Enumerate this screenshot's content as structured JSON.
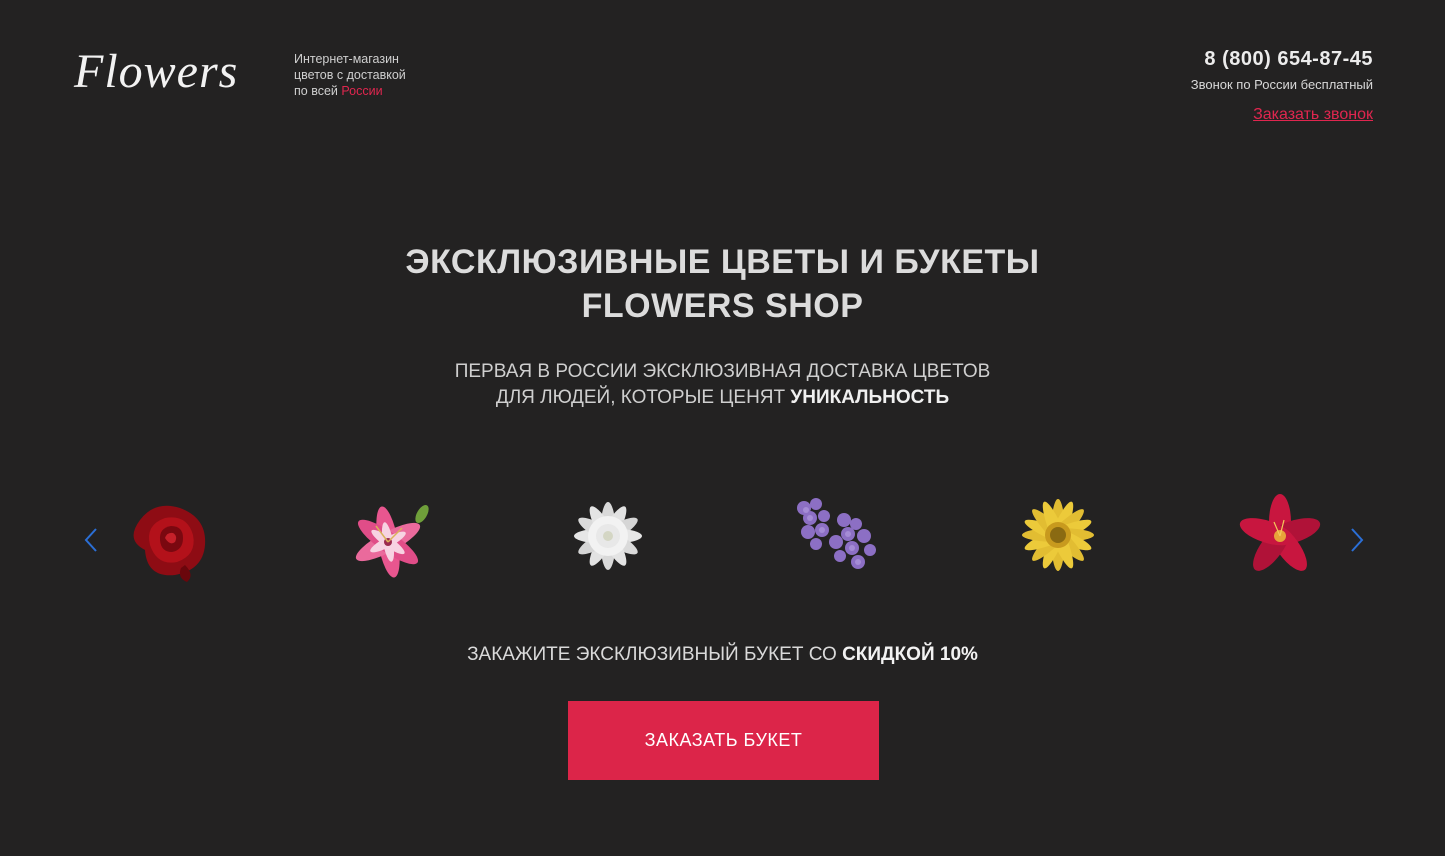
{
  "header": {
    "logo": "Flowers",
    "tagline": {
      "line1": "Интернет-магазин",
      "line2": "цветов с доставкой",
      "line3_prefix": "по всей ",
      "line3_accent": "России"
    },
    "phone": "8 (800) 654-87-45",
    "phone_note": "Звонок по России бесплатный",
    "callback_link": "Заказать звонок"
  },
  "hero": {
    "title_line1": "ЭКСКЛЮЗИВНЫЕ ЦВЕТЫ И БУКЕТЫ",
    "title_line2": "FLOWERS SHOP",
    "subtitle_line1": "ПЕРВАЯ В РОССИИ ЭКСКЛЮЗИВНАЯ ДОСТАВКА ЦВЕТОВ",
    "subtitle_line2_prefix": "ДЛЯ ЛЮДЕЙ, КОТОРЫЕ ЦЕНЯТ ",
    "subtitle_line2_bold": "УНИКАЛЬНОСТЬ"
  },
  "carousel": {
    "prev_icon": "chevron-left-icon",
    "next_icon": "chevron-right-icon",
    "items": [
      {
        "name": "rose",
        "color": "#b3111a"
      },
      {
        "name": "lily",
        "color": "#e8568f"
      },
      {
        "name": "dahlia",
        "color": "#eeeeee"
      },
      {
        "name": "lilac",
        "color": "#8c6fc4"
      },
      {
        "name": "gerbera",
        "color": "#ecca3a"
      },
      {
        "name": "alstroemeria",
        "color": "#c8163f"
      }
    ]
  },
  "offer": {
    "prefix": "ЗАКАЖИТЕ ЭКСКЛЮЗИВНЫЙ БУКЕТ СО ",
    "bold": "СКИДКОЙ 10%"
  },
  "cta": {
    "label": "ЗАКАЗАТЬ БУКЕТ"
  },
  "colors": {
    "background": "#232222",
    "accent": "#e0264f",
    "button": "#dc2549",
    "arrow": "#2b6fd6"
  }
}
